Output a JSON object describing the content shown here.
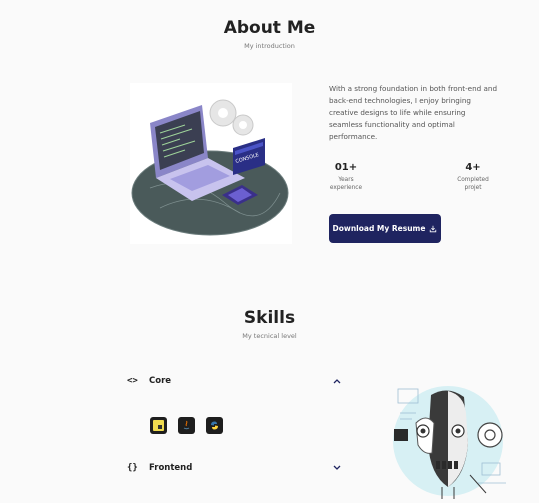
{
  "about": {
    "title": "About Me",
    "subtitle": "My introduction",
    "description": "With a strong foundation in both front-end and back-end technologies, I enjoy bringing creative designs to life while ensuring seamless functionality and optimal performance.",
    "stats": [
      {
        "value": "01+",
        "label_line1": "Years",
        "label_line2": "experience"
      },
      {
        "value": "4+",
        "label_line1": "Completed",
        "label_line2": "projet"
      }
    ],
    "download_label": "Download My Resume",
    "illustration_sign": "CONSOLE"
  },
  "skills": {
    "title": "Skills",
    "subtitle": "My tecnical level",
    "groups": [
      {
        "icon": "<>",
        "label": "Core",
        "expanded": true,
        "techs": [
          "javascript-icon",
          "java-icon",
          "python-icon"
        ]
      },
      {
        "icon": "{}",
        "label": "Frontend",
        "expanded": false
      }
    ]
  },
  "colors": {
    "background": "#fafafa",
    "accent": "#1f2460",
    "text": "#222222",
    "muted": "#777777"
  }
}
